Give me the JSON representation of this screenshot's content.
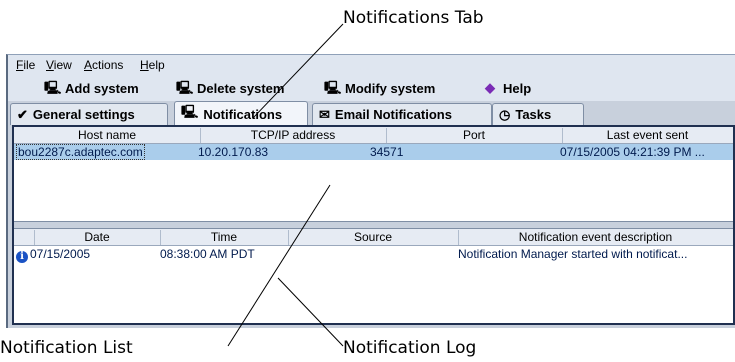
{
  "callouts": {
    "tab": "Notifications Tab",
    "list": "Notification List",
    "log": "Notification Log"
  },
  "menu": {
    "file": "ile",
    "view": "iew",
    "actions": "ctions",
    "help": "elp",
    "file_key": "F",
    "view_key": "V",
    "actions_key": "A",
    "help_key": "H"
  },
  "toolbar": {
    "add": "Add system",
    "delete": "Delete system",
    "modify": "Modify system",
    "help": "Help"
  },
  "tabs": {
    "general": "General settings",
    "notifications": "Notifications",
    "email": "Email Notifications",
    "tasks": "Tasks"
  },
  "list": {
    "headers": [
      "Host name",
      "TCP/IP address",
      "Port",
      "Last event sent"
    ],
    "row": {
      "host": "bou2287c.adaptec.com",
      "ip": "10.20.170.83",
      "port": "34571",
      "last": "07/15/2005 04:21:39 PM ..."
    }
  },
  "log": {
    "headers": [
      "Date",
      "Time",
      "Source",
      "Notification event description"
    ],
    "row": {
      "date": "07/15/2005",
      "time": "08:38:00 AM PDT",
      "source": "",
      "desc": "Notification Manager started with notificat..."
    }
  },
  "colors": {
    "selection": "#aacdeb",
    "window_bg": "#c8d0dc",
    "info_icon": "#1a52c4"
  }
}
